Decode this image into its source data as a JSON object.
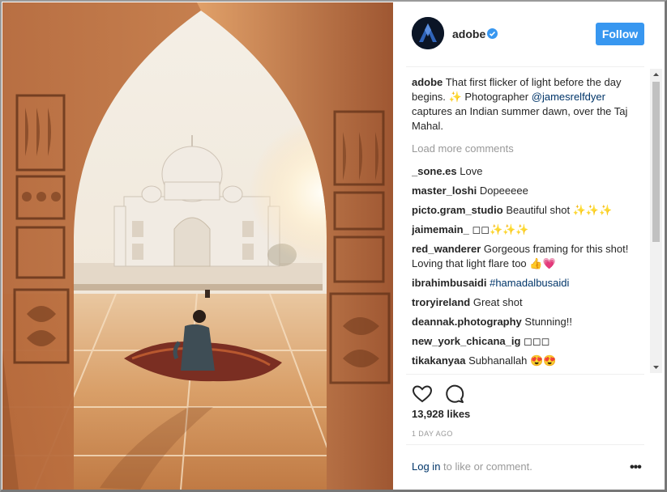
{
  "post": {
    "username": "adobe",
    "follow_label": "Follow",
    "caption": {
      "user": "adobe",
      "text_before_mention": "That first flicker of light before the day begins. ✨ Photographer",
      "mention": "@jamesrelfdyer",
      "text_after_mention": "captures an Indian summer dawn, over the Taj Mahal."
    },
    "load_more_label": "Load more comments",
    "comments": [
      {
        "user": "_sone.es",
        "text": "Love"
      },
      {
        "user": "master_loshi",
        "text": "Dopeeeee"
      },
      {
        "user": "picto.gram_studio",
        "text": "Beautiful shot ✨✨✨"
      },
      {
        "user": "jaimemain_",
        "text": "◻◻✨✨✨"
      },
      {
        "user": "red_wanderer",
        "text": "Gorgeous framing for this shot! Loving that light flare too 👍💗"
      },
      {
        "user": "ibrahimbusaidi",
        "text": "#hamadalbusaidi"
      },
      {
        "user": "troryireland",
        "text": "Great shot"
      },
      {
        "user": "deannak.photography",
        "text": "Stunning!!"
      },
      {
        "user": "new_york_chicana_ig",
        "text": "◻◻◻"
      },
      {
        "user": "tikakanyaa",
        "text": "Subhanallah 😍😍"
      }
    ],
    "likes": "13,928 likes",
    "time": "1 DAY AGO",
    "login_link": "Log in",
    "login_rest": "to like or comment.",
    "more_label": "•••"
  },
  "icons": {
    "like": "heart-icon",
    "comment": "comment-icon",
    "verified": "verified-badge-icon",
    "more": "more-options-icon"
  },
  "colors": {
    "accent": "#3897f0",
    "link": "#003569",
    "muted": "#999999"
  }
}
